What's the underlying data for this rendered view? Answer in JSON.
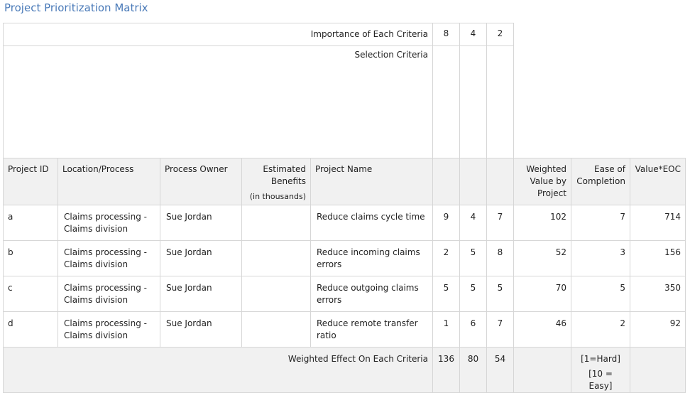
{
  "title": "Project Prioritization Matrix",
  "importance": {
    "label": "Importance of Each Criteria",
    "values": [
      "8",
      "4",
      "2"
    ]
  },
  "selection_criteria_label": "Selection Criteria",
  "columns": {
    "project_id": "Project ID",
    "location": "Location/Process",
    "owner": "Process Owner",
    "benefits": "Estimated Benefits",
    "benefits_sub": "(in thousands)",
    "project_name": "Project Name",
    "weighted": "Weighted Value by Project",
    "ease": "Ease of Completion",
    "value_eoc": "Value*EOC"
  },
  "rows": [
    {
      "id": "a",
      "location": "Claims processing - Claims division",
      "owner": "Sue Jordan",
      "benefits": "",
      "name": "Reduce claims cycle time",
      "c1": "9",
      "c2": "4",
      "c3": "7",
      "weighted": "102",
      "ease": "7",
      "value": "714"
    },
    {
      "id": "b",
      "location": "Claims processing - Claims division",
      "owner": "Sue Jordan",
      "benefits": "",
      "name": "Reduce incoming claims errors",
      "c1": "2",
      "c2": "5",
      "c3": "8",
      "weighted": "52",
      "ease": "3",
      "value": "156"
    },
    {
      "id": "c",
      "location": "Claims processing - Claims division",
      "owner": "Sue Jordan",
      "benefits": "",
      "name": "Reduce outgoing claims errors",
      "c1": "5",
      "c2": "5",
      "c3": "5",
      "weighted": "70",
      "ease": "5",
      "value": "350"
    },
    {
      "id": "d",
      "location": "Claims processing - Claims division",
      "owner": "Sue Jordan",
      "benefits": "",
      "name": "Reduce remote transfer ratio",
      "c1": "1",
      "c2": "6",
      "c3": "7",
      "weighted": "46",
      "ease": "2",
      "value": "92"
    }
  ],
  "footer": {
    "label": "Weighted Effect On Each Criteria",
    "values": [
      "136",
      "80",
      "54"
    ],
    "ease_hard": "[1=Hard]",
    "ease_easy": "[10 = Easy]"
  }
}
